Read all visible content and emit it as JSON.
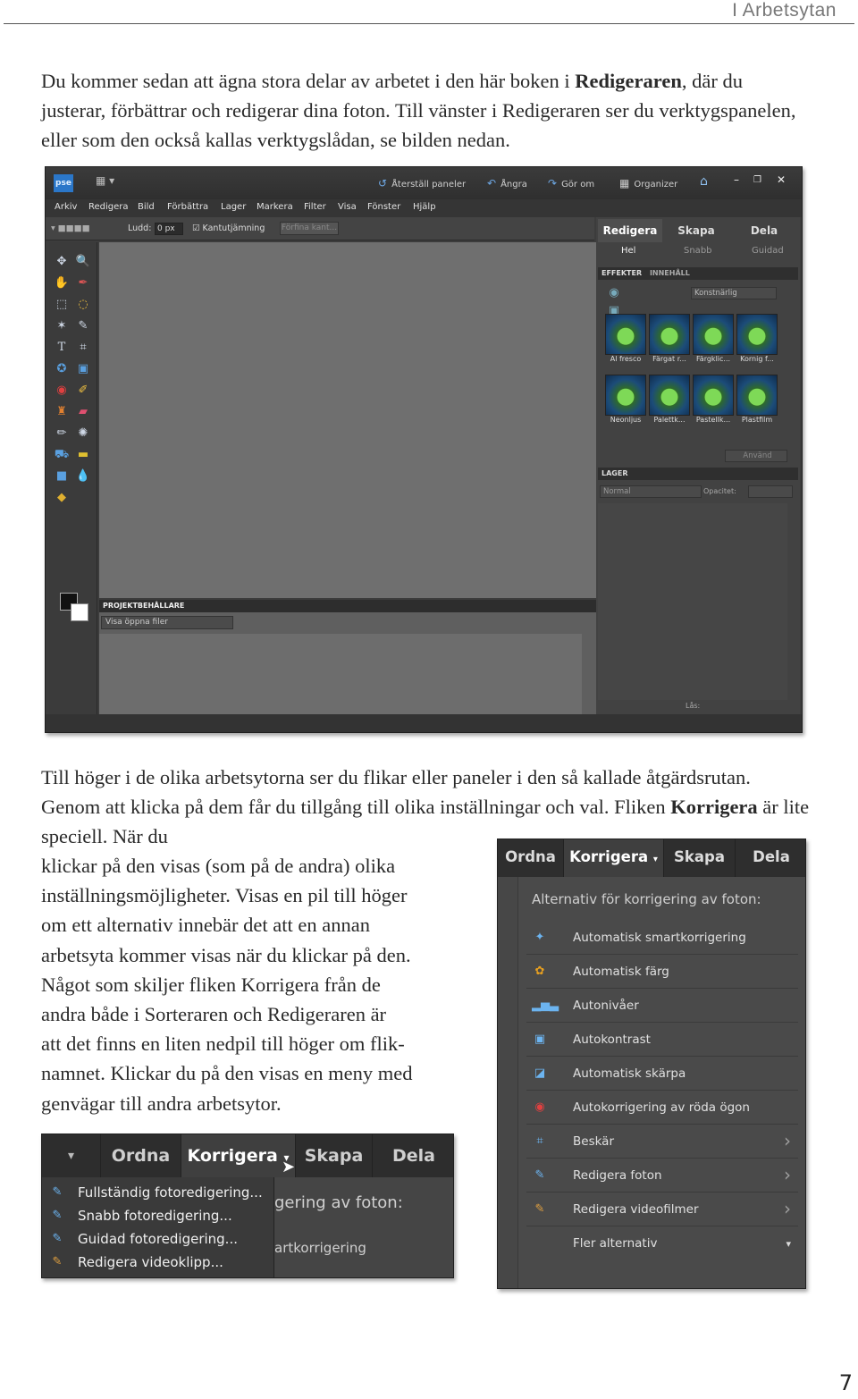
{
  "running_head": "I Arbetsytan",
  "page_number": "7",
  "intro": {
    "t1": "Du kommer sedan att ägna stora delar av arbetet i den här boken i ",
    "b1": "Redigeraren",
    "t2": ", där du justerar, förbättrar och redigerar dina foton. Till vänster i Redigeraren ser du verktygspanelen, eller som den också kallas verktygslådan, se bilden nedan."
  },
  "para2": {
    "t1": "Till höger i de olika arbetsytorna ser du flikar eller paneler i den så kallade åtgärdsrutan. Genom att klicka på dem får du tillgång till olika inställningar och val. Fliken ",
    "b1": "Korrigera",
    "t2": " är lite speciell. När du"
  },
  "para3_lines": [
    "klickar på den visas (som på de andra) olika",
    "inställningsmöjligheter. Visas en pil till höger",
    "om ett alternativ innebär det att en annan",
    "arbetsyta kommer visas när du klickar på den.",
    "Något som skiljer fliken Korrigera från de",
    "andra både i Sorteraren och Redigeraren är",
    "att det finns en liten nedpil till höger om flik-",
    "namnet. Klickar du på den visas en meny med",
    "genvägar till andra arbetsytor."
  ],
  "editor": {
    "logo": "pse",
    "toolbar": [
      "Återställ paneler",
      "Ångra",
      "Gör om",
      "Organizer"
    ],
    "menus": [
      "Arkiv",
      "Redigera",
      "Bild",
      "Förbättra",
      "Lager",
      "Markera",
      "Filter",
      "Visa",
      "Fönster",
      "Hjälp"
    ],
    "options": {
      "ludd_label": "Ludd:",
      "ludd_value": "0 px",
      "kant_label": "Kantutjämning",
      "refine_btn": "Förfina kant..."
    },
    "right_tabs": [
      "Redigera",
      "Skapa",
      "Dela"
    ],
    "right_subtabs": [
      "Hel",
      "Snabb",
      "Guidad"
    ],
    "effects_tabs": [
      "EFFEKTER",
      "INNEHÅLL"
    ],
    "effects_select": "Konstnärlig",
    "thumbs_row1": [
      "Al fresco",
      "Färgat r...",
      "Färgklic...",
      "Kornig f..."
    ],
    "thumbs_row2": [
      "Neonljus",
      "Palettk...",
      "Pastellk...",
      "Plastfilm"
    ],
    "apply_btn": "Använd",
    "layers_head": "LAGER",
    "blend_mode": "Normal",
    "opacity_label": "Opacitet:",
    "lock_label": "Lås:",
    "project_head": "PROJEKTBEHÅLLARE",
    "project_select": "Visa öppna filer"
  },
  "korrigera_panel": {
    "tabs": [
      "Ordna",
      "Korrigera",
      "Skapa",
      "Dela"
    ],
    "heading": "Alternativ för korrigering av foton:",
    "items": [
      {
        "label": "Automatisk smartkorrigering",
        "icon": "wand-icon",
        "arrow": false
      },
      {
        "label": "Automatisk färg",
        "icon": "color-wheel-icon",
        "arrow": false
      },
      {
        "label": "Autonivåer",
        "icon": "levels-icon",
        "arrow": false
      },
      {
        "label": "Autokontrast",
        "icon": "contrast-icon",
        "arrow": false
      },
      {
        "label": "Automatisk skärpa",
        "icon": "sharpen-icon",
        "arrow": false
      },
      {
        "label": "Autokorrigering av röda ögon",
        "icon": "red-eye-icon",
        "arrow": false
      },
      {
        "label": "Beskär",
        "icon": "crop-icon",
        "arrow": true
      },
      {
        "label": "Redigera foton",
        "icon": "edit-photo-icon",
        "arrow": true
      },
      {
        "label": "Redigera videofilmer",
        "icon": "edit-video-icon",
        "arrow": true
      },
      {
        "label": "Fler alternativ",
        "icon": "",
        "arrow": false
      }
    ]
  },
  "menu_shot": {
    "tabs": [
      "Ordna",
      "Korrigera",
      "Skapa",
      "Dela"
    ],
    "behind_heading": "gering av foton:",
    "behind_item": "artkorrigering",
    "menu_items": [
      "Fullständig fotoredigering...",
      "Snabb fotoredigering...",
      "Guidad fotoredigering...",
      "Redigera videoklipp..."
    ]
  }
}
